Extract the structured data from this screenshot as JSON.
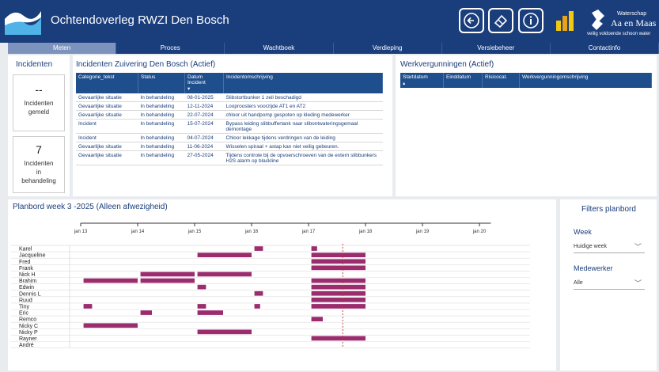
{
  "header": {
    "title": "Ochtendoverleg RWZI Den Bosch",
    "brand_top": "Waterschap",
    "brand_name": "Aa en Maas",
    "brand_tagline": "veilig voldoende schoon water"
  },
  "tabs": [
    "Meten",
    "Proces",
    "Wachtboek",
    "Verdieping",
    "Versiebeheer",
    "Contactinfo"
  ],
  "incidenten": {
    "title": "Incidenten",
    "card1": {
      "value": "--",
      "label1": "Incidenten",
      "label2": "gemeld"
    },
    "card2": {
      "value": "7",
      "label1": "Incidenten",
      "label2": "in",
      "label3": "behandeling"
    }
  },
  "zuivering": {
    "title": "Incidenten Zuivering Den Bosch (Actief)",
    "headers": [
      "Categorie_tekst",
      "Status",
      "Datum Incident",
      "Incidentomschrijving"
    ],
    "rows": [
      [
        "Gevaarlijke situatie",
        "In behandeling",
        "08-01-2025",
        "Slibstortbunker 1 zeil beschadigd"
      ],
      [
        "Gevaarlijke situatie",
        "In behandeling",
        "12-11-2024",
        "Looproosters voorzijde AT1 en AT2"
      ],
      [
        "Gevaarlijke situatie",
        "In behandeling",
        "22-07-2024",
        "chloor uit handpomp gespoten op kleding medewerker"
      ],
      [
        "Incident",
        "In behandeling",
        "15-07-2024",
        "Bypass leiding slibbuffertank naar slibontwateringsgemaal demontage"
      ],
      [
        "Incident",
        "In behandeling",
        "04-07-2024",
        "Chloor lekkage tijdens verdringen van de leiding"
      ],
      [
        "Gevaarlijke situatie",
        "In behandeling",
        "11-06-2024",
        "Wisselen spiraal + astap kan niet veilig gebeuren."
      ],
      [
        "Gevaarlijke situatie",
        "In behandeling",
        "27-05-2024",
        "Tijdens controle bij de opvoerschroeven van de extern slibbunkers H2S alarm op blackline"
      ]
    ]
  },
  "werk": {
    "title": "Werkvergunningen (Actief)",
    "headers": [
      "Startdatum",
      "Einddatum",
      "Risicocat.",
      "Werkvergunningomschrijving"
    ]
  },
  "planbord": {
    "title": "Planbord week 3 -2025 (Alleen afwezigheid)",
    "axis_labels": [
      "jan 13",
      "jan 14",
      "jan 15",
      "jan 16",
      "jan 17",
      "jan 18",
      "jan 19",
      "jan 20"
    ],
    "today_marker": 17.6,
    "bar_color": "#9b2c6e",
    "people": [
      "Karel",
      "Jacqueline",
      "Fred",
      "Frank",
      "Nick H",
      "Brahim",
      "Edwin",
      "Dennis L",
      "Ruud",
      "Tiny",
      "Eric",
      "Remco",
      "Nicky C",
      "Nicky P",
      "Rayner",
      "André"
    ],
    "absences": [
      {
        "person": "Karel",
        "start": 16.05,
        "end": 16.2
      },
      {
        "person": "Karel",
        "start": 17.05,
        "end": 17.15
      },
      {
        "person": "Jacqueline",
        "start": 15.05,
        "end": 16.0
      },
      {
        "person": "Jacqueline",
        "start": 17.05,
        "end": 18.0
      },
      {
        "person": "Fred",
        "start": 17.05,
        "end": 18.0
      },
      {
        "person": "Frank",
        "start": 17.05,
        "end": 18.0
      },
      {
        "person": "Nick H",
        "start": 14.05,
        "end": 15.0
      },
      {
        "person": "Nick H",
        "start": 15.05,
        "end": 16.0
      },
      {
        "person": "Brahim",
        "start": 13.05,
        "end": 14.0
      },
      {
        "person": "Brahim",
        "start": 14.05,
        "end": 15.0
      },
      {
        "person": "Brahim",
        "start": 17.05,
        "end": 18.0
      },
      {
        "person": "Edwin",
        "start": 15.05,
        "end": 15.2
      },
      {
        "person": "Edwin",
        "start": 17.05,
        "end": 18.0
      },
      {
        "person": "Dennis L",
        "start": 16.05,
        "end": 16.2
      },
      {
        "person": "Dennis L",
        "start": 17.05,
        "end": 18.0
      },
      {
        "person": "Ruud",
        "start": 17.05,
        "end": 18.0
      },
      {
        "person": "Tiny",
        "start": 13.05,
        "end": 13.2
      },
      {
        "person": "Tiny",
        "start": 15.05,
        "end": 15.2
      },
      {
        "person": "Tiny",
        "start": 16.05,
        "end": 16.15
      },
      {
        "person": "Tiny",
        "start": 17.05,
        "end": 18.0
      },
      {
        "person": "Eric",
        "start": 14.05,
        "end": 14.25
      },
      {
        "person": "Eric",
        "start": 15.05,
        "end": 15.5
      },
      {
        "person": "Remco",
        "start": 17.05,
        "end": 17.25
      },
      {
        "person": "Nicky C",
        "start": 13.05,
        "end": 14.0
      },
      {
        "person": "Nicky P",
        "start": 15.05,
        "end": 16.0
      },
      {
        "person": "Rayner",
        "start": 17.05,
        "end": 18.0
      }
    ]
  },
  "filters": {
    "title": "Filters planbord",
    "week_label": "Week",
    "week_value": "Huidige week",
    "mw_label": "Medewerker",
    "mw_value": "Alle"
  }
}
